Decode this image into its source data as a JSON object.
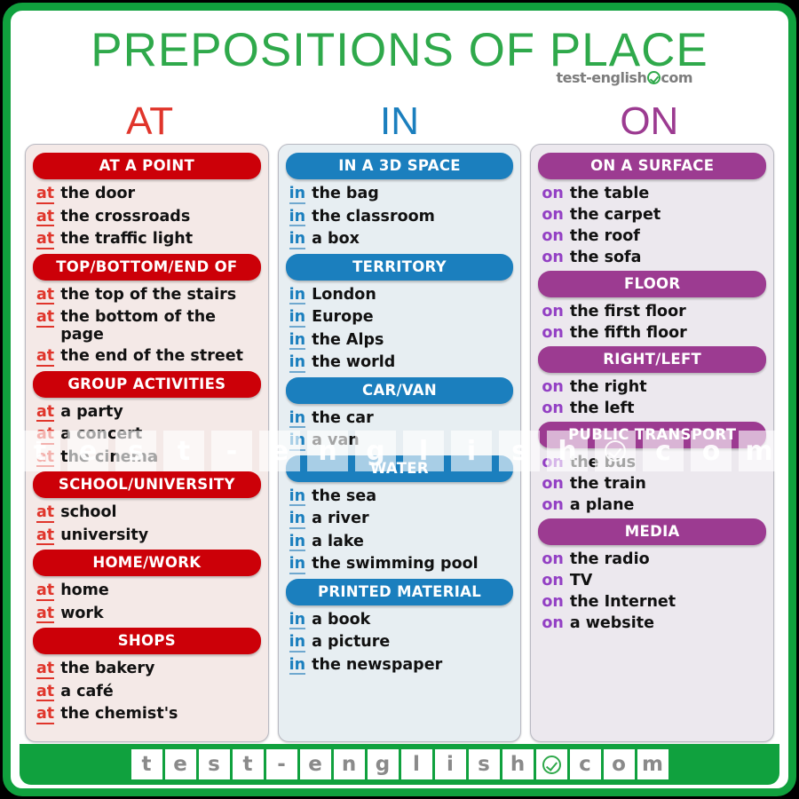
{
  "header": {
    "title": "PREPOSITIONS OF PLACE",
    "brand_left": "test-english",
    "brand_icon": "check-circle-icon",
    "brand_right": "com"
  },
  "colors": {
    "frame_green": "#10a13e",
    "title_green": "#2fa94b",
    "at_red": "#cc0008",
    "in_blue": "#1b7fbe",
    "on_purple": "#9c3b91",
    "at_word": "#e0352b",
    "in_word": "#1b7fbe",
    "on_word": "#9340c4",
    "at_card_bg": "#f4e9e7",
    "in_card_bg": "#e7eef2",
    "on_card_bg": "#ece8ee"
  },
  "columns": [
    {
      "letter": "AT",
      "key": "at",
      "groups": [
        {
          "banner": "AT A POINT",
          "items": [
            {
              "prep": "at",
              "rest": "the door"
            },
            {
              "prep": "at",
              "rest": "the crossroads"
            },
            {
              "prep": "at",
              "rest": "the traffic light"
            }
          ]
        },
        {
          "banner": "TOP/BOTTOM/END OF",
          "items": [
            {
              "prep": "at",
              "rest": "the top  of the stairs"
            },
            {
              "prep": "at",
              "rest": "the bottom of the page"
            },
            {
              "prep": "at",
              "rest": "the end of the street"
            }
          ]
        },
        {
          "banner": "GROUP ACTIVITIES",
          "items": [
            {
              "prep": "at",
              "rest": "a party"
            },
            {
              "prep": "at",
              "rest": "a concert"
            },
            {
              "prep": "at",
              "rest": "the cinema"
            }
          ]
        },
        {
          "banner": "SCHOOL/UNIVERSITY",
          "items": [
            {
              "prep": "at",
              "rest": "school"
            },
            {
              "prep": "at",
              "rest": "university"
            }
          ]
        },
        {
          "banner": "HOME/WORK",
          "items": [
            {
              "prep": "at",
              "rest": "home"
            },
            {
              "prep": "at",
              "rest": "work"
            }
          ]
        },
        {
          "banner": "SHOPS",
          "items": [
            {
              "prep": "at",
              "rest": "the bakery"
            },
            {
              "prep": "at",
              "rest": "a café"
            },
            {
              "prep": "at",
              "rest": "the chemist's"
            }
          ]
        }
      ]
    },
    {
      "letter": "IN",
      "key": "in",
      "groups": [
        {
          "banner": "IN A 3D SPACE",
          "items": [
            {
              "prep": "in",
              "rest": "the bag"
            },
            {
              "prep": "in",
              "rest": "the classroom"
            },
            {
              "prep": "in",
              "rest": "a box"
            }
          ]
        },
        {
          "banner": "TERRITORY",
          "items": [
            {
              "prep": "in",
              "rest": "London"
            },
            {
              "prep": "in",
              "rest": "Europe"
            },
            {
              "prep": "in",
              "rest": "the Alps"
            },
            {
              "prep": "in",
              "rest": "the world"
            }
          ]
        },
        {
          "banner": "CAR/VAN",
          "items": [
            {
              "prep": "in",
              "rest": "the car"
            },
            {
              "prep": "in",
              "rest": "a van"
            }
          ]
        },
        {
          "banner": "WATER",
          "items": [
            {
              "prep": "in",
              "rest": "the sea"
            },
            {
              "prep": "in",
              "rest": "a river"
            },
            {
              "prep": "in",
              "rest": "a lake"
            },
            {
              "prep": "in",
              "rest": "the swimming pool"
            }
          ]
        },
        {
          "banner": "PRINTED MATERIAL",
          "items": [
            {
              "prep": "in",
              "rest": "a book"
            },
            {
              "prep": "in",
              "rest": "a picture"
            },
            {
              "prep": "in",
              "rest": "the newspaper"
            }
          ]
        }
      ]
    },
    {
      "letter": "ON",
      "key": "on",
      "groups": [
        {
          "banner": "ON A SURFACE",
          "items": [
            {
              "prep": "on",
              "rest": "the table"
            },
            {
              "prep": "on",
              "rest": "the carpet"
            },
            {
              "prep": "on",
              "rest": "the roof"
            },
            {
              "prep": "on",
              "rest": "the sofa"
            }
          ]
        },
        {
          "banner": "FLOOR",
          "items": [
            {
              "prep": "on",
              "rest": "the first floor"
            },
            {
              "prep": "on",
              "rest": "the fifth floor"
            }
          ]
        },
        {
          "banner": "RIGHT/LEFT",
          "items": [
            {
              "prep": "on",
              "rest": "the right"
            },
            {
              "prep": "on",
              "rest": "the left"
            }
          ]
        },
        {
          "banner": "PUBLIC TRANSPORT",
          "items": [
            {
              "prep": "on",
              "rest": "the bus"
            },
            {
              "prep": "on",
              "rest": "the train"
            },
            {
              "prep": "on",
              "rest": "a plane"
            }
          ]
        },
        {
          "banner": "MEDIA",
          "items": [
            {
              "prep": "on",
              "rest": "the radio"
            },
            {
              "prep": "on",
              "rest": "TV"
            },
            {
              "prep": "on",
              "rest": "the Internet"
            },
            {
              "prep": "on",
              "rest": "a website"
            }
          ]
        }
      ]
    }
  ],
  "watermark": {
    "tiles": [
      "t",
      "e",
      "s",
      "t",
      "-",
      "e",
      "n",
      "g",
      "l",
      "i",
      "s",
      "h",
      "check-circle-icon",
      "c",
      "o",
      "m"
    ]
  },
  "footer": {
    "tiles": [
      "t",
      "e",
      "s",
      "t",
      "-",
      "e",
      "n",
      "g",
      "l",
      "i",
      "s",
      "h",
      "check-circle-icon",
      "c",
      "o",
      "m"
    ]
  }
}
